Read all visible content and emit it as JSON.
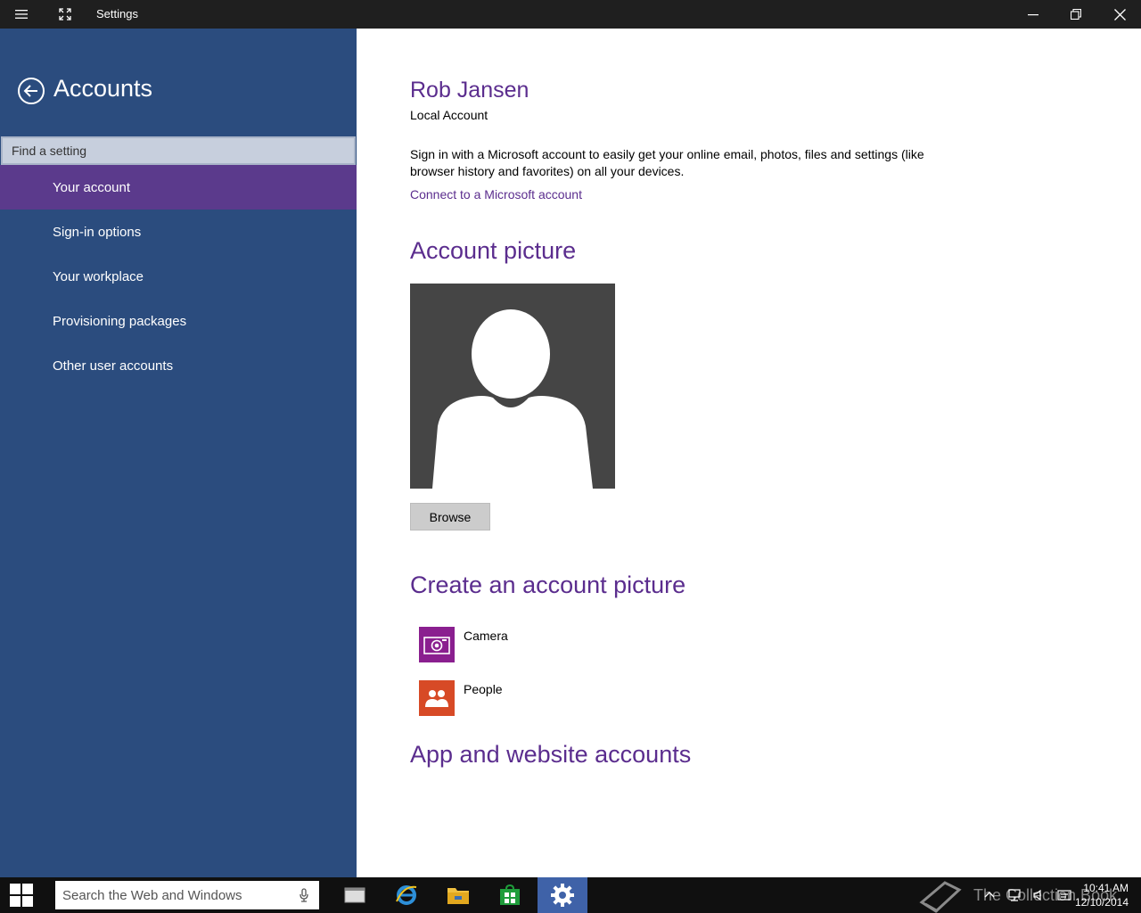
{
  "window": {
    "title": "Settings",
    "menu_icon": "hamburger-icon",
    "expand_icon": "expand-icon",
    "controls": [
      "minimize-icon",
      "restore-icon",
      "close-icon"
    ]
  },
  "sidebar": {
    "title": "Accounts",
    "back_icon": "back-arrow-icon",
    "search_placeholder": "Find a setting",
    "items": [
      {
        "label": "Your account",
        "active": true
      },
      {
        "label": "Sign-in options",
        "active": false
      },
      {
        "label": "Your workplace",
        "active": false
      },
      {
        "label": "Provisioning packages",
        "active": false
      },
      {
        "label": "Other user accounts",
        "active": false
      }
    ]
  },
  "main": {
    "user_name": "Rob Jansen",
    "account_type": "Local Account",
    "signin_text": "Sign in with a Microsoft account to easily get your online email, photos, files and settings (like browser history and favorites) on all your devices.",
    "connect_link": "Connect to a Microsoft account",
    "picture_heading": "Account picture",
    "browse_label": "Browse",
    "create_heading": "Create an account picture",
    "apps": [
      {
        "label": "Camera",
        "icon": "camera-icon",
        "color": "#8a1f8f"
      },
      {
        "label": "People",
        "icon": "people-icon",
        "color": "#d74a26"
      }
    ],
    "app_accounts_heading": "App and website accounts"
  },
  "taskbar": {
    "search_placeholder": "Search the Web and Windows",
    "apps": [
      "task-view-icon",
      "internet-explorer-icon",
      "file-explorer-icon",
      "store-icon",
      "settings-icon"
    ],
    "time": "10:41 AM",
    "date": "12/10/2014",
    "watermark": "The Collection Book"
  },
  "colors": {
    "sidebar_bg": "#2b4c7e",
    "active_item": "#5b3a8c",
    "accent": "#5b2d8e",
    "titlebar": "#1f1f1f",
    "taskbar": "#101010"
  }
}
